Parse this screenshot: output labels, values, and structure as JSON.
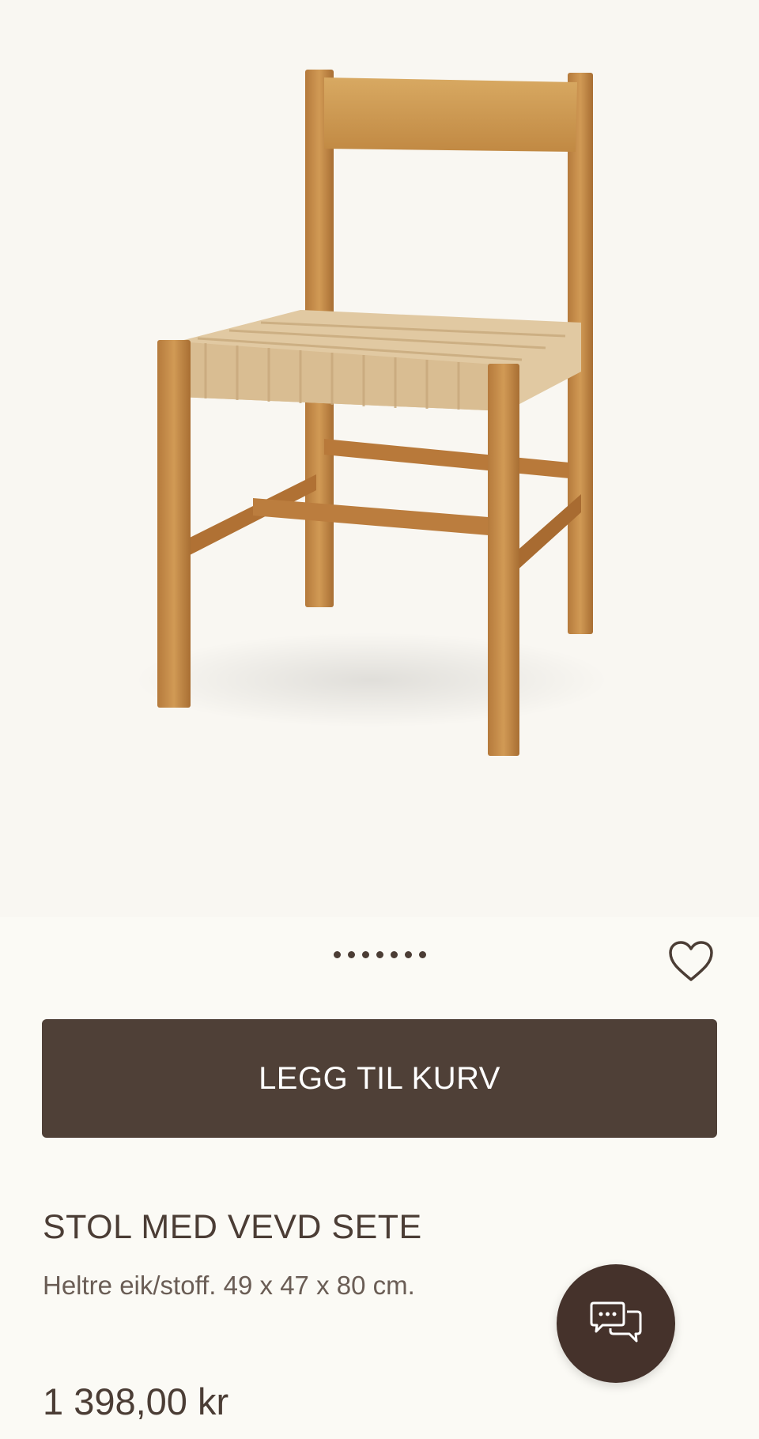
{
  "product": {
    "title": "STOL MED VEVD SETE",
    "description": "Heltre eik/stoff. 49 x 47 x 80 cm.",
    "price": "1 398,00 kr"
  },
  "actions": {
    "add_to_cart_label": "LEGG TIL KURV"
  },
  "gallery": {
    "dots": 7
  },
  "icons": {
    "wishlist": "heart-icon",
    "chat": "chat-bubbles-icon"
  },
  "colors": {
    "background": "#fbfaf5",
    "primary_button": "#4f4037",
    "text": "#4b3d35",
    "chat_button": "#45322b"
  }
}
